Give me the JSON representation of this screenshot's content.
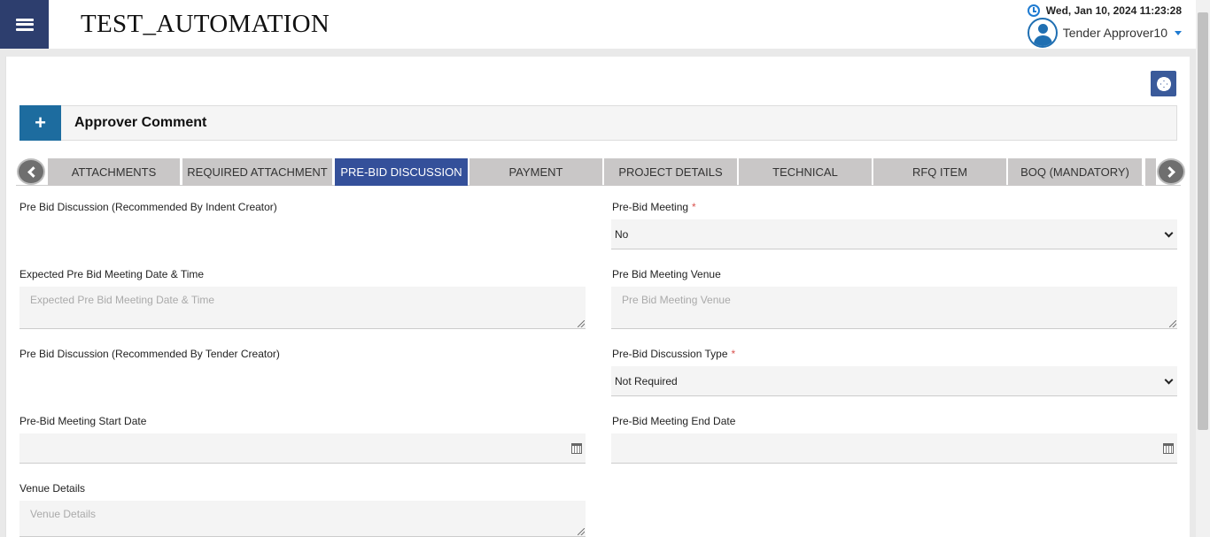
{
  "header": {
    "app_title": "TEST_AUTOMATION",
    "datetime": "Wed, Jan 10, 2024 11:23:28",
    "user_name": "Tender Approver10"
  },
  "panel": {
    "title": "Approver Comment",
    "expand_symbol": "+"
  },
  "tabs": [
    {
      "label": "ATTACHMENTS",
      "active": false
    },
    {
      "label": "REQUIRED ATTACHMENT",
      "active": false
    },
    {
      "label": "PRE-BID DISCUSSION",
      "active": true
    },
    {
      "label": "PAYMENT",
      "active": false
    },
    {
      "label": "PROJECT DETAILS",
      "active": false
    },
    {
      "label": "TECHNICAL",
      "active": false
    },
    {
      "label": "RFQ ITEM",
      "active": false
    },
    {
      "label": "BOQ (MANDATORY)",
      "active": false
    }
  ],
  "form": {
    "indent_creator_label": "Pre Bid Discussion (Recommended By Indent Creator)",
    "pre_bid_meeting_label": "Pre-Bid Meeting",
    "pre_bid_meeting_value": "No",
    "expected_date_label": "Expected Pre Bid Meeting Date & Time",
    "expected_date_placeholder": "Expected Pre Bid Meeting Date & Time",
    "venue_label": "Pre Bid Meeting Venue",
    "venue_placeholder": "Pre Bid Meeting Venue",
    "tender_creator_label": "Pre Bid Discussion (Recommended By Tender Creator)",
    "discussion_type_label": "Pre-Bid Discussion Type",
    "discussion_type_value": "Not Required",
    "start_date_label": "Pre-Bid Meeting Start Date",
    "end_date_label": "Pre-Bid Meeting End Date",
    "venue_details_label": "Venue Details",
    "venue_details_placeholder": "Venue Details",
    "required_marker": "*"
  },
  "colors": {
    "header_menu": "#2d3e6e",
    "active_tab": "#34509a",
    "inactive_tab": "#c9c7c7",
    "panel_button": "#1d6c9f",
    "required": "#d9534f"
  }
}
